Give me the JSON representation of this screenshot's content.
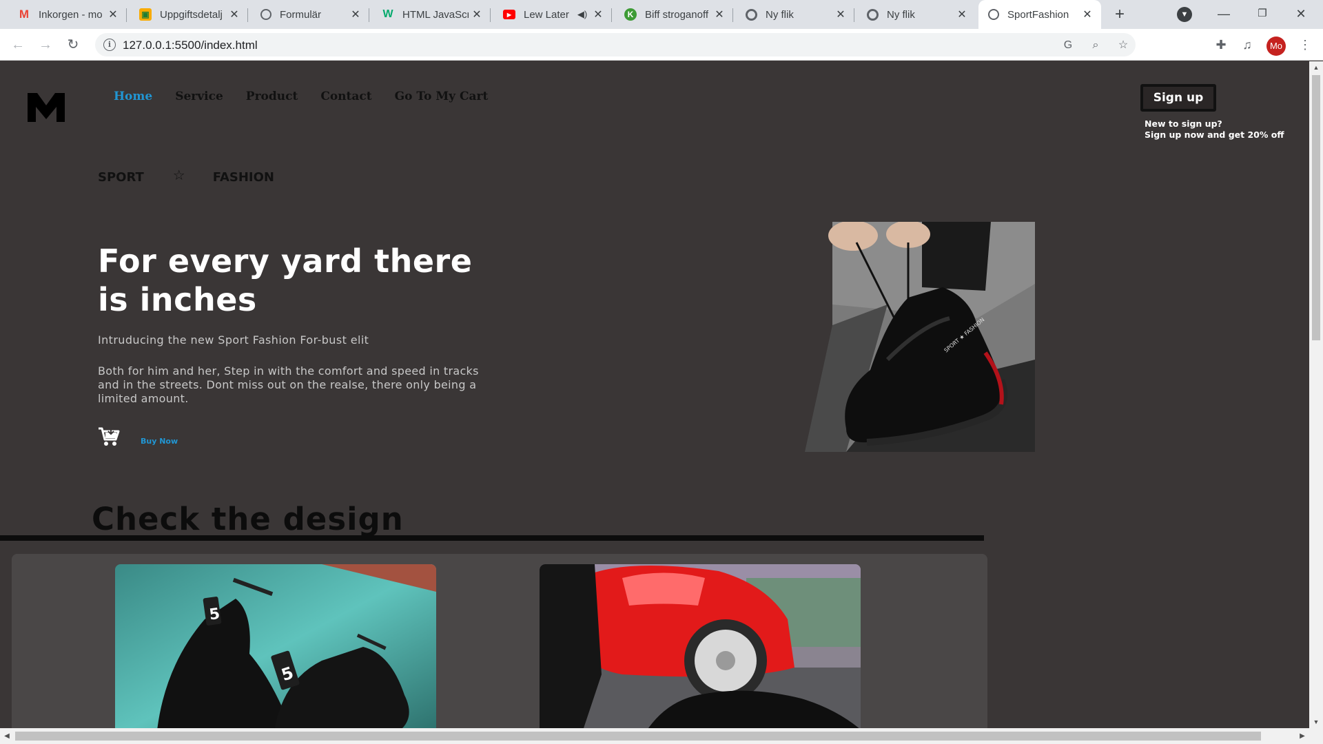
{
  "browser": {
    "tabs": [
      {
        "title": "Inkorgen - mo",
        "icon": "gmail-icon",
        "active": false
      },
      {
        "title": "Uppgiftsdetalj",
        "icon": "classroom-icon",
        "active": false
      },
      {
        "title": "Formulär",
        "icon": "globe-icon",
        "active": false
      },
      {
        "title": "HTML JavaScri",
        "icon": "w3schools-icon",
        "active": false
      },
      {
        "title": "Lew Later",
        "icon": "youtube-icon",
        "active": false
      },
      {
        "title": "Biff stroganoff",
        "icon": "recipe-icon",
        "active": false
      },
      {
        "title": "Ny flik",
        "icon": "chrome-icon",
        "active": false
      },
      {
        "title": "Ny flik",
        "icon": "chrome-icon",
        "active": false
      },
      {
        "title": "SportFashion",
        "icon": "globe-icon",
        "active": true
      }
    ],
    "url": "127.0.0.1:5500/index.html",
    "profile_initials": "Mo"
  },
  "page": {
    "nav": [
      "Home",
      "Service",
      "Product",
      "Contact",
      "Go To My Cart"
    ],
    "signup_label": "Sign up",
    "promo_line1": "New to sign up?",
    "promo_line2": "Sign up now and get 20% off",
    "brand_left": "SPORT",
    "brand_star": "☆",
    "brand_right": "FASHION",
    "hero_title": "For every yard there is inches",
    "hero_subtitle": "Intruducing the new Sport Fashion For-bust elit",
    "hero_text": "Both for him and her, Step in with the comfort and speed in tracks and in the streets. Dont miss out on the realse, there only being a limited amount.",
    "buy_now": "Buy Now",
    "section_title": "Check the design"
  },
  "colors": {
    "page_bg": "#3a3636",
    "accent": "#2196d3",
    "nav_text": "#111111"
  }
}
